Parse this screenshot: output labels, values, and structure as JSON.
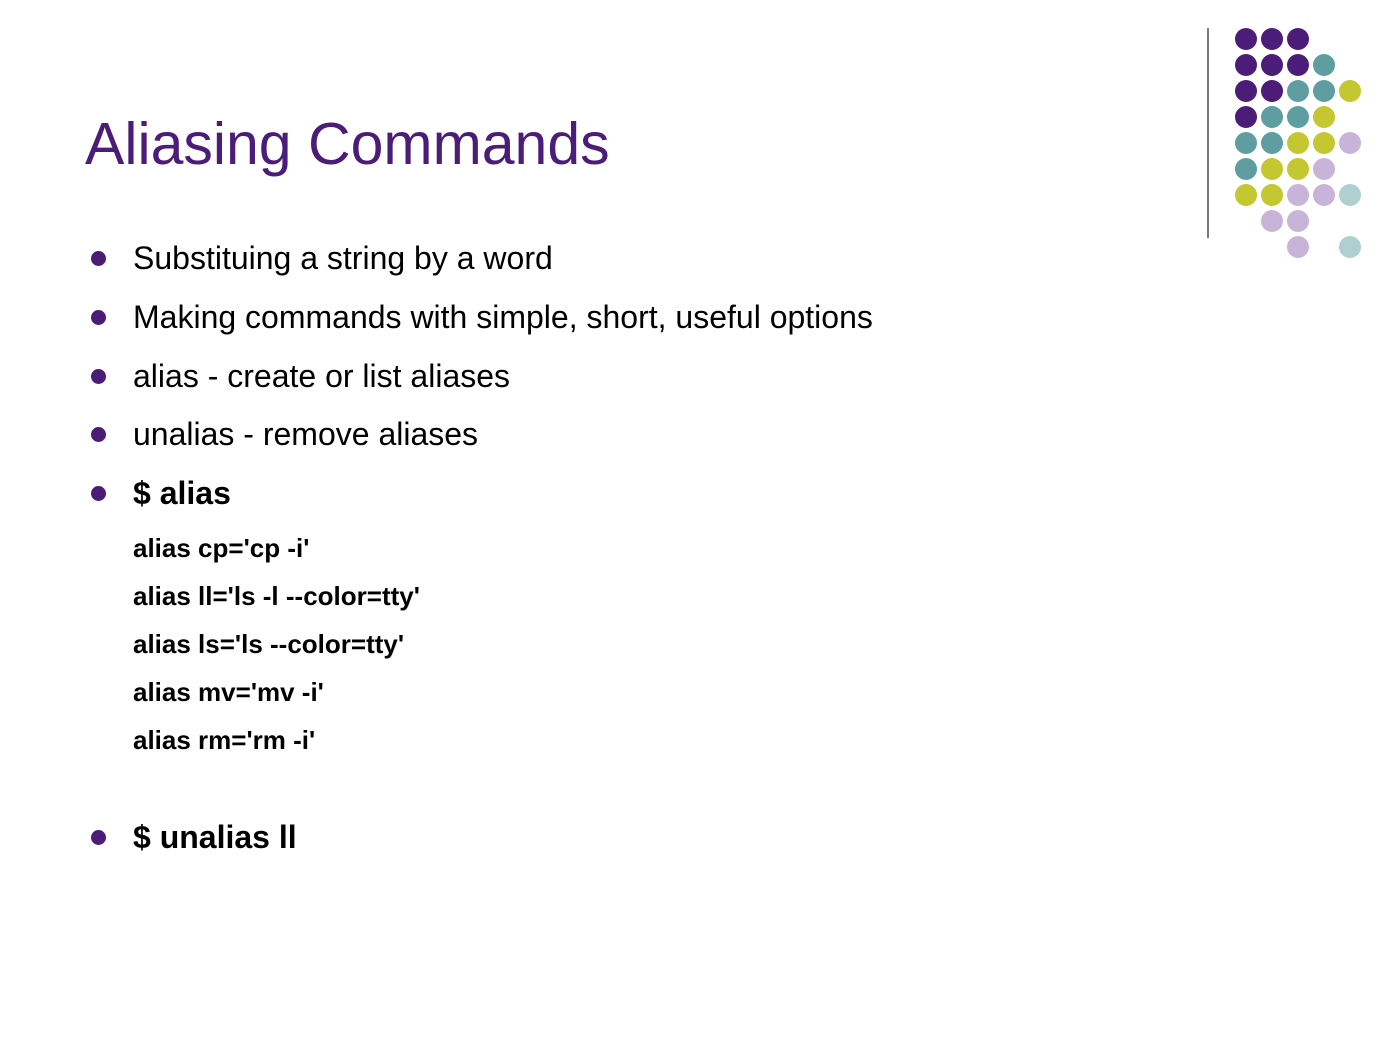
{
  "title": "Aliasing Commands",
  "bullets": {
    "b1": "Substituing a string by a word",
    "b2": "Making commands with simple, short, useful options",
    "b3": "alias - create or list aliases",
    "b4": "unalias - remove aliases",
    "b5": "$ alias",
    "b6": "$ unalias ll"
  },
  "alias_output": {
    "l1": "alias cp='cp -i'",
    "l2": "alias ll='ls -l --color=tty'",
    "l3": "alias ls='ls --color=tty'",
    "l4": "alias mv='mv -i'",
    "l5": "alias rm='rm -i'"
  }
}
